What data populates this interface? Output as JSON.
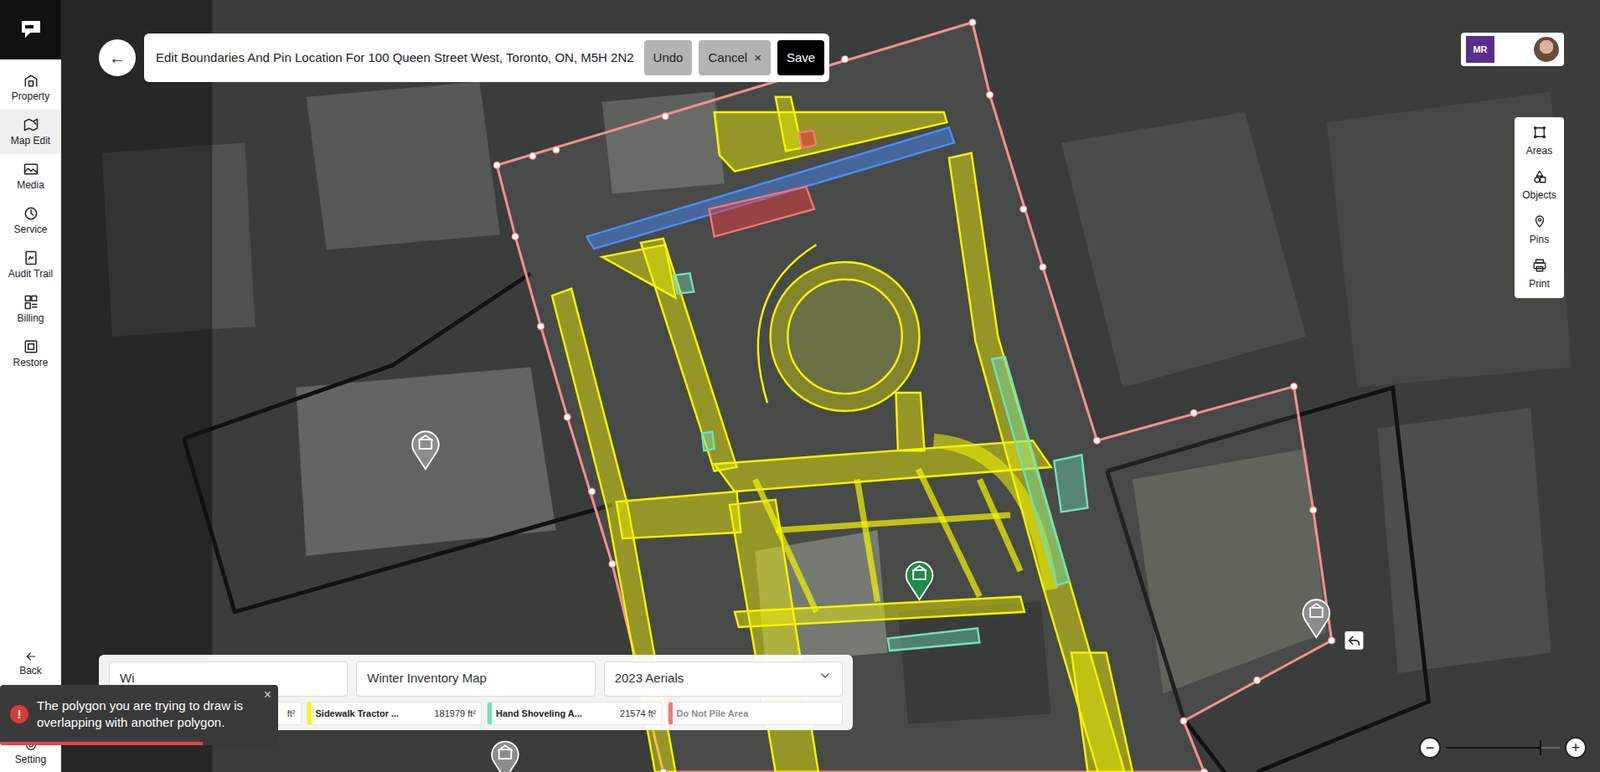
{
  "sidebar": {
    "items": [
      {
        "label": "Property",
        "selected": false
      },
      {
        "label": "Map Edit",
        "selected": true
      },
      {
        "label": "Media",
        "selected": false
      },
      {
        "label": "Service",
        "selected": false
      },
      {
        "label": "Audit Trail",
        "selected": false
      },
      {
        "label": "Billing",
        "selected": false
      },
      {
        "label": "Restore",
        "selected": false
      }
    ],
    "footer": [
      {
        "label": "Back"
      },
      {
        "label": "Setting"
      }
    ]
  },
  "header": {
    "back": "←",
    "title": "Edit Boundaries And Pin Location For 100 Queen Street West, Toronto, ON, M5H 2N2",
    "buttons": [
      {
        "label": "Undo",
        "kind": "secondary"
      },
      {
        "label": "Cancel",
        "icon": "×",
        "kind": "secondary"
      },
      {
        "label": "Save",
        "kind": "primary"
      }
    ]
  },
  "account": {
    "logo": "MR"
  },
  "tools": [
    {
      "label": "Areas"
    },
    {
      "label": "Objects"
    },
    {
      "label": "Pins"
    },
    {
      "label": "Print"
    }
  ],
  "panel": {
    "fields": [
      {
        "value": "Wi",
        "kind": "text"
      },
      {
        "value": "Winter Inventory Map",
        "kind": "text"
      },
      {
        "value": "2023 Aerials",
        "kind": "dropdown"
      }
    ],
    "legend": [
      {
        "area": "ft²"
      },
      {
        "name": "Sidewalk Tractor ...",
        "area": "181979 ft²",
        "color": "#f5f500",
        "muted": false
      },
      {
        "name": "Hand Shoveling A...",
        "area": "21574 ft²",
        "color": "#6fe0bd",
        "muted": false
      },
      {
        "name": "Do Not Pile Area",
        "color": "#f07878",
        "muted": true
      }
    ]
  },
  "map": {
    "pins": [
      {
        "kind": "property"
      },
      {
        "kind": "building"
      },
      {
        "kind": "building"
      },
      {
        "kind": "building"
      }
    ]
  },
  "zoom": {
    "minus": "−",
    "plus": "+",
    "level": 0.83
  },
  "toast": {
    "icon": "!",
    "message": "The polygon you are trying to draw is overlapping with another polygon.",
    "close": "×",
    "level": 0.73
  }
}
